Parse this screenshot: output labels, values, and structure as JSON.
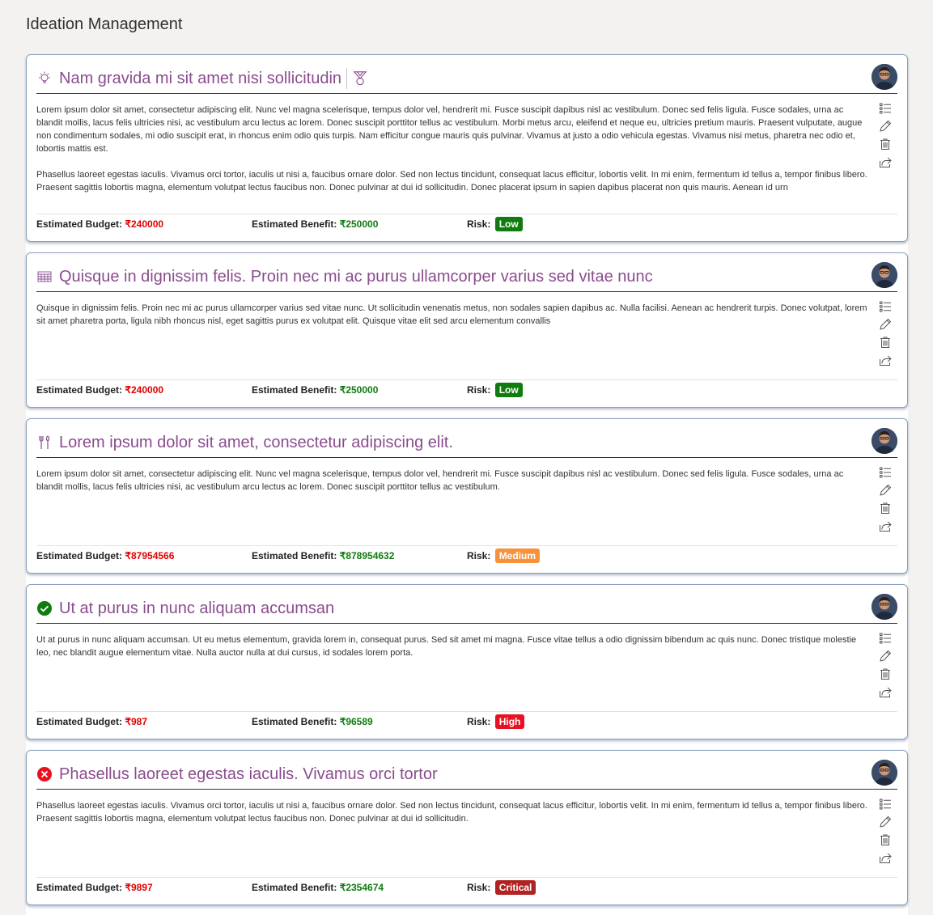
{
  "page": {
    "title": "Ideation Management"
  },
  "labels": {
    "budget": "Estimated Budget:",
    "benefit": "Estimated Benefit:",
    "risk": "Risk:"
  },
  "colors": {
    "title": "#8a4c8d",
    "budget": "#e00000",
    "benefit": "#0f7b0f",
    "risk_low": "#107c10",
    "risk_medium": "#f7923a",
    "risk_high": "#e81123",
    "risk_critical": "#b22222"
  },
  "actions": [
    "list-icon",
    "edit-pencil-icon",
    "delete-trash-icon",
    "share-icon"
  ],
  "ideas": [
    {
      "title": "Nam gravida mi sit amet nisi sollicitudin",
      "status_icon": "lightbulb-icon",
      "extra_icon": "medal-icon",
      "paragraphs": [
        "Lorem ipsum dolor sit amet, consectetur adipiscing elit. Nunc vel magna scelerisque, tempus dolor vel, hendrerit mi. Fusce suscipit dapibus nisl ac vestibulum. Donec sed felis ligula. Fusce sodales, urna ac blandit mollis, lacus felis ultricies nisi, ac vestibulum arcu lectus ac lorem. Donec suscipit porttitor tellus ac vestibulum. Morbi metus arcu, eleifend et neque eu, ultricies pretium mauris. Praesent vulputate, augue non condimentum sodales, mi odio suscipit erat, in rhoncus enim odio quis turpis. Nam efficitur congue mauris quis pulvinar. Vivamus at justo a odio vehicula egestas. Vivamus nisi metus, pharetra nec odio et, lobortis mattis est.",
        "Phasellus laoreet egestas iaculis. Vivamus orci tortor, iaculis ut nisi a, faucibus ornare dolor. Sed non lectus tincidunt, consequat lacus efficitur, lobortis velit. In mi enim, fermentum id tellus a, tempor finibus libero. Praesent sagittis lobortis magna, elementum volutpat lectus faucibus non. Donec pulvinar at dui id sollicitudin. Donec placerat ipsum in sapien dapibus placerat non quis mauris. Aenean id urn"
      ],
      "budget": "₹240000",
      "benefit": "₹250000",
      "risk": "Low",
      "risk_color": "#107c10"
    },
    {
      "title": "Quisque in dignissim felis. Proin nec mi ac purus ullamcorper varius sed vitae nunc",
      "status_icon": "calendar-grid-icon",
      "paragraphs": [
        "Quisque in dignissim felis. Proin nec mi ac purus ullamcorper varius sed vitae nunc. Ut sollicitudin venenatis metus, non sodales sapien dapibus ac. Nulla facilisi. Aenean ac hendrerit turpis. Donec volutpat, lorem sit amet pharetra porta, ligula nibh rhoncus nisl, eget sagittis purus ex volutpat elit. Quisque vitae elit sed arcu elementum convallis"
      ],
      "budget": "₹240000",
      "benefit": "₹250000",
      "risk": "Low",
      "risk_color": "#107c10"
    },
    {
      "title": "Lorem ipsum dolor sit amet, consectetur adipiscing elit.",
      "status_icon": "tools-icon",
      "paragraphs": [
        "Lorem ipsum dolor sit amet, consectetur adipiscing elit. Nunc vel magna scelerisque, tempus dolor vel, hendrerit mi. Fusce suscipit dapibus nisl ac vestibulum. Donec sed felis ligula. Fusce sodales, urna ac blandit mollis, lacus felis ultricies nisi, ac vestibulum arcu lectus ac lorem. Donec suscipit porttitor tellus ac vestibulum."
      ],
      "budget": "₹87954566",
      "benefit": "₹878954632",
      "risk": "Medium",
      "risk_color": "#f7923a"
    },
    {
      "title": "Ut at purus in nunc aliquam accumsan",
      "status_icon": "checkmark-circle-icon",
      "paragraphs": [
        "Ut at purus in nunc aliquam accumsan. Ut eu metus elementum, gravida lorem in, consequat purus. Sed sit amet mi magna. Fusce vitae tellus a odio dignissim bibendum ac quis nunc. Donec tristique molestie leo, nec blandit augue elementum vitae. Nulla auctor nulla at dui cursus, id sodales lorem porta."
      ],
      "budget": "₹987",
      "benefit": "₹96589",
      "risk": "High",
      "risk_color": "#e81123"
    },
    {
      "title": "Phasellus laoreet egestas iaculis. Vivamus orci tortor",
      "status_icon": "error-circle-icon",
      "paragraphs": [
        "Phasellus laoreet egestas iaculis. Vivamus orci tortor, iaculis ut nisi a, faucibus ornare dolor. Sed non lectus tincidunt, consequat lacus efficitur, lobortis velit. In mi enim, fermentum id tellus a, tempor finibus libero. Praesent sagittis lobortis magna, elementum volutpat lectus faucibus non. Donec pulvinar at dui id sollicitudin."
      ],
      "budget": "₹9897",
      "benefit": "₹2354674",
      "risk": "Critical",
      "risk_color": "#b22222"
    }
  ]
}
